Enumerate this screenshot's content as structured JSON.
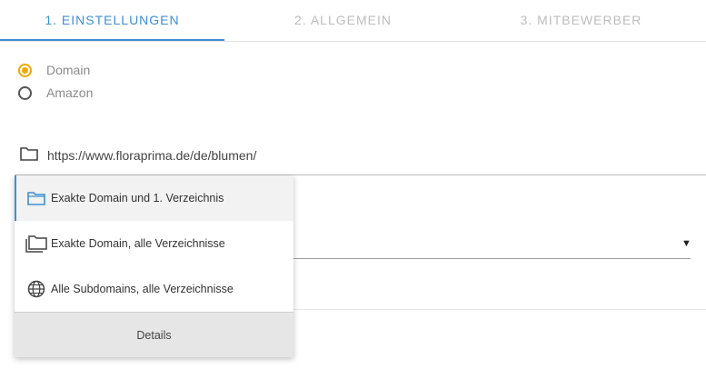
{
  "tabs": [
    {
      "label": "1. EINSTELLUNGEN",
      "active": true
    },
    {
      "label": "2. ALLGEMEIN",
      "active": false
    },
    {
      "label": "3. MITBEWERBER",
      "active": false
    }
  ],
  "source": {
    "options": [
      {
        "label": "Domain",
        "checked": true
      },
      {
        "label": "Amazon",
        "checked": false
      }
    ]
  },
  "url": {
    "value": "https://www.floraprima.de/de/blumen/",
    "icon": "folder-icon"
  },
  "dropdown": {
    "items": [
      {
        "label": "Exakte Domain und 1. Verzeichnis",
        "icon": "folder-icon",
        "selected": true
      },
      {
        "label": "Exakte Domain, alle Verzeichnisse",
        "icon": "folders-icon",
        "selected": false
      },
      {
        "label": "Alle Subdomains, alle Verzeichnisse",
        "icon": "globe-icon",
        "selected": false
      }
    ],
    "details_label": "Details"
  },
  "select": {
    "arrow": "▼"
  },
  "colors": {
    "accent": "#3f8fd2",
    "radio_checked": "#f0a800"
  }
}
